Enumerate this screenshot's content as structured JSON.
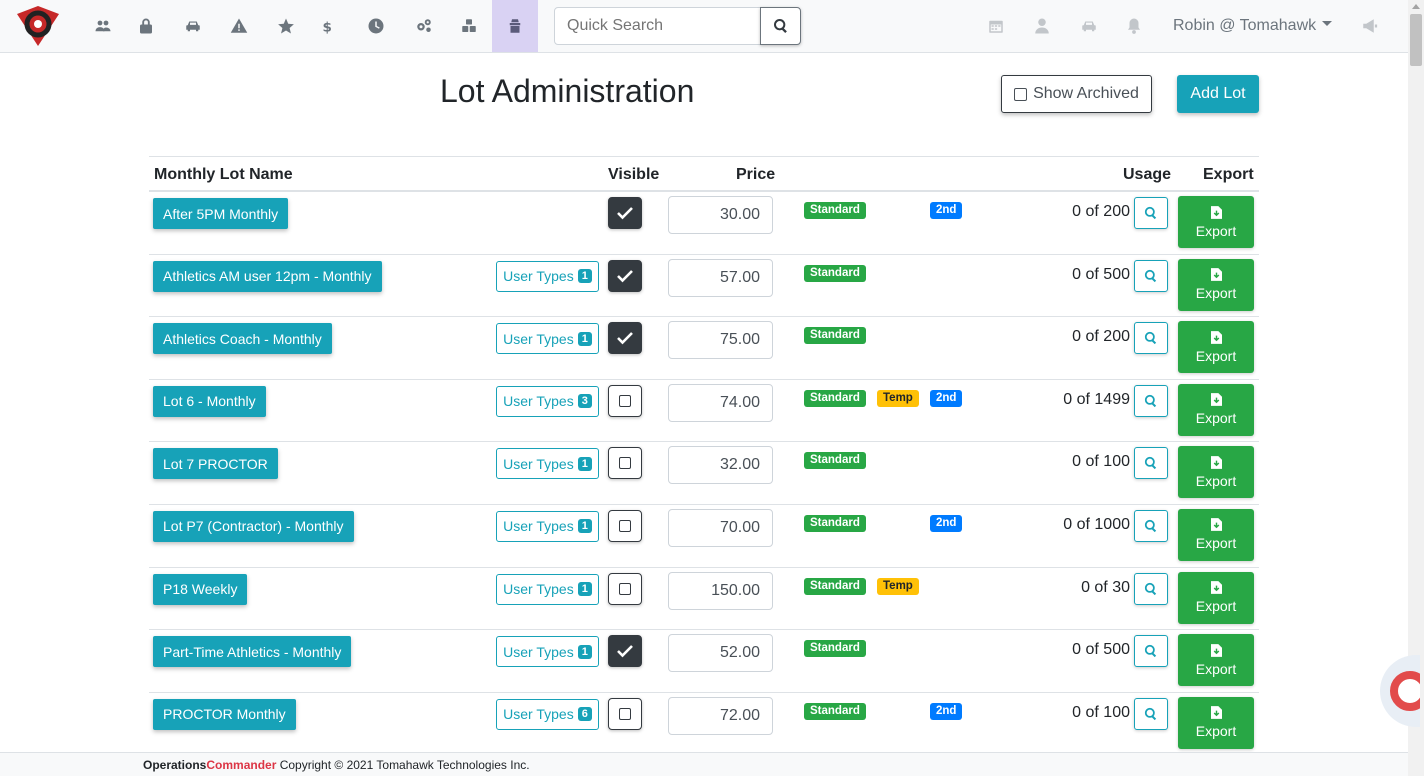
{
  "header": {
    "search_placeholder": "Quick Search",
    "user_label": "Robin @ Tomahawk"
  },
  "page": {
    "title": "Lot Administration",
    "show_archived_label": "Show Archived",
    "add_lot_label": "Add Lot"
  },
  "table": {
    "col_name": "Monthly Lot Name",
    "col_visible": "Visible",
    "col_price": "Price",
    "col_usage": "Usage",
    "col_export": "Export",
    "user_types_label": "User Types",
    "export_label": "Export",
    "rows": [
      {
        "name": "After 5PM Monthly",
        "user_types": null,
        "visible": true,
        "price": "30.00",
        "standard": "Standard",
        "temp": null,
        "second": "2nd",
        "usage": "0 of 200"
      },
      {
        "name": "Athletics AM user 12pm - Monthly",
        "user_types": "1",
        "visible": true,
        "price": "57.00",
        "standard": "Standard",
        "temp": null,
        "second": null,
        "usage": "0 of 500"
      },
      {
        "name": "Athletics Coach - Monthly",
        "user_types": "1",
        "visible": true,
        "price": "75.00",
        "standard": "Standard",
        "temp": null,
        "second": null,
        "usage": "0 of 200"
      },
      {
        "name": "Lot 6 - Monthly",
        "user_types": "3",
        "visible": false,
        "price": "74.00",
        "standard": "Standard",
        "temp": "Temp",
        "second": "2nd",
        "usage": "0 of 1499"
      },
      {
        "name": "Lot 7 PROCTOR",
        "user_types": "1",
        "visible": false,
        "price": "32.00",
        "standard": "Standard",
        "temp": null,
        "second": null,
        "usage": "0 of 100"
      },
      {
        "name": "Lot P7 (Contractor) - Monthly",
        "user_types": "1",
        "visible": false,
        "price": "70.00",
        "standard": "Standard",
        "temp": null,
        "second": "2nd",
        "usage": "0 of 1000"
      },
      {
        "name": "P18 Weekly",
        "user_types": "1",
        "visible": false,
        "price": "150.00",
        "standard": "Standard",
        "temp": "Temp",
        "second": null,
        "usage": "0 of 30"
      },
      {
        "name": "Part-Time Athletics - Monthly",
        "user_types": "1",
        "visible": true,
        "price": "52.00",
        "standard": "Standard",
        "temp": null,
        "second": null,
        "usage": "0 of 500"
      },
      {
        "name": "PROCTOR Monthly",
        "user_types": "6",
        "visible": false,
        "price": "72.00",
        "standard": "Standard",
        "temp": null,
        "second": "2nd",
        "usage": "0 of 100"
      }
    ]
  },
  "footer": {
    "brand_a": "Operations",
    "brand_b": "Commander",
    "copyright": " Copyright © 2021 Tomahawk Technologies Inc."
  },
  "nav_icons": [
    "users-icon",
    "lock-icon",
    "car-icon",
    "warning-icon",
    "star-icon",
    "dollar-icon",
    "clock-icon",
    "cogs-icon",
    "cubes-icon",
    "lot-admin-icon"
  ],
  "right_icons": [
    "calendar-icon",
    "user-icon",
    "car-icon",
    "bell-icon",
    "megaphone-icon"
  ],
  "colors": {
    "teal": "#17a2b8",
    "green": "#28a745",
    "yellow": "#ffc107",
    "blue": "#007bff",
    "dark": "#343a40",
    "brand_red": "#dc3545"
  }
}
